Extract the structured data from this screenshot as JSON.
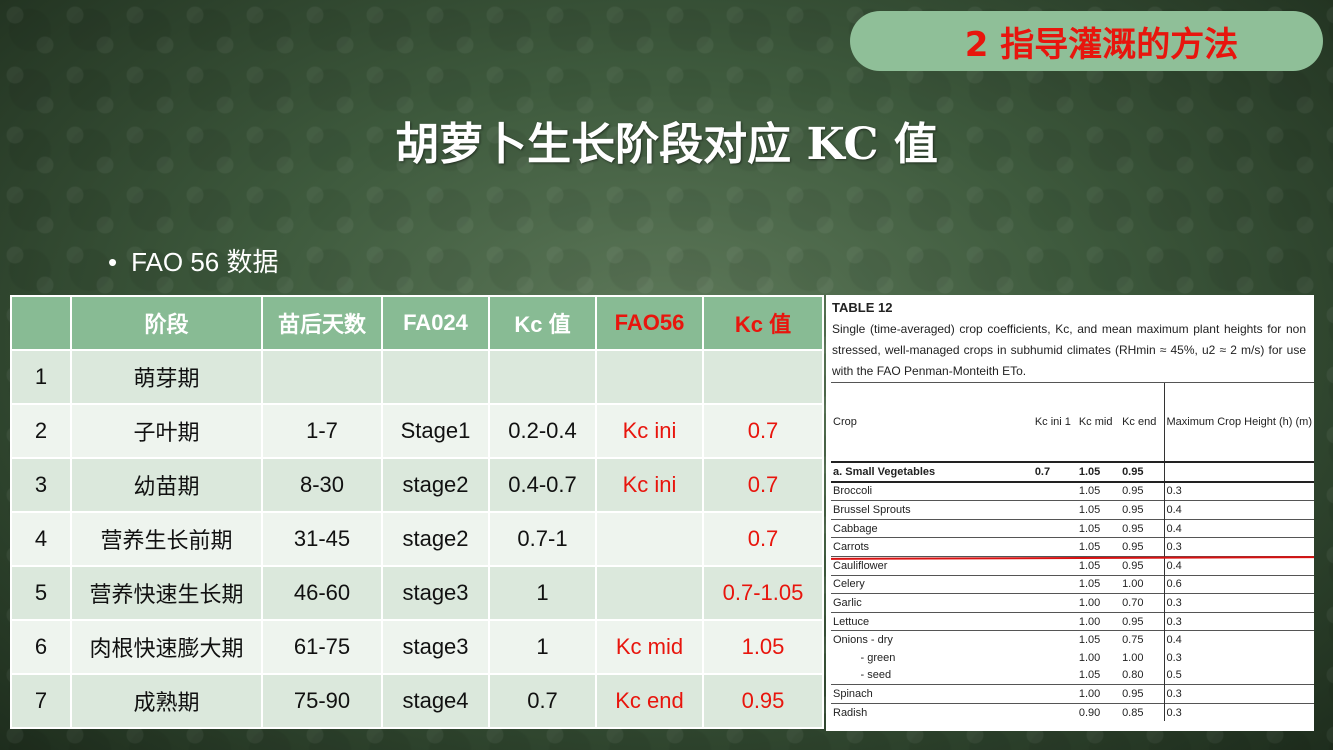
{
  "section_badge": "2 指导灌溉的方法",
  "title": "胡萝卜生长阶段对应 KC 值",
  "bullet": "FAO 56  数据",
  "table": {
    "headers": [
      "",
      "阶段",
      "苗后天数",
      "FA024",
      "Kc 值",
      "FAO56",
      "Kc 值"
    ],
    "rows": [
      [
        "1",
        "萌芽期",
        "",
        "",
        "",
        "",
        ""
      ],
      [
        "2",
        "子叶期",
        "1-7",
        "Stage1",
        "0.2-0.4",
        "Kc ini",
        "0.7"
      ],
      [
        "3",
        "幼苗期",
        "8-30",
        "stage2",
        "0.4-0.7",
        "Kc ini",
        "0.7"
      ],
      [
        "4",
        "营养生长前期",
        "31-45",
        "stage2",
        "0.7-1",
        "",
        "0.7"
      ],
      [
        "5",
        "营养快速生长期",
        "46-60",
        "stage3",
        "1",
        "",
        "0.7-1.05"
      ],
      [
        "6",
        "肉根快速膨大期",
        "61-75",
        "stage3",
        "1",
        "Kc mid",
        "1.05"
      ],
      [
        "7",
        "成熟期",
        "75-90",
        "stage4",
        "0.7",
        "Kc end",
        "0.95"
      ]
    ],
    "accent_color": "#e8150d",
    "header_bg": "#88bb94"
  },
  "fao_image": {
    "table_label": "TABLE 12",
    "caption": "Single (time-averaged) crop coefficients, Kc, and mean maximum plant heights for non stressed, well-managed crops in subhumid climates (RHmin ≈ 45%, u2 ≈ 2 m/s) for use with the FAO Penman-Monteith ETo.",
    "headers": [
      "Crop",
      "Kc ini 1",
      "Kc mid",
      "Kc end",
      "Maximum Crop Height (h) (m)"
    ],
    "section": [
      "a.  Small Vegetables",
      "0.7",
      "1.05",
      "0.95",
      ""
    ],
    "rows": [
      [
        "Broccoli",
        "",
        "1.05",
        "0.95",
        "0.3"
      ],
      [
        "Brussel Sprouts",
        "",
        "1.05",
        "0.95",
        "0.4"
      ],
      [
        "Cabbage",
        "",
        "1.05",
        "0.95",
        "0.4"
      ],
      [
        "Carrots",
        "",
        "1.05",
        "0.95",
        "0.3"
      ],
      [
        "Cauliflower",
        "",
        "1.05",
        "0.95",
        "0.4"
      ],
      [
        "Celery",
        "",
        "1.05",
        "1.00",
        "0.6"
      ],
      [
        "Garlic",
        "",
        "1.00",
        "0.70",
        "0.3"
      ],
      [
        "Lettuce",
        "",
        "1.00",
        "0.95",
        "0.3"
      ],
      [
        "Onions - dry",
        "",
        "1.05",
        "0.75",
        "0.4"
      ],
      [
        "         - green",
        "",
        "1.00",
        "1.00",
        "0.3"
      ],
      [
        "         - seed",
        "",
        "1.05",
        "0.80",
        "0.5"
      ],
      [
        "Spinach",
        "",
        "1.00",
        "0.95",
        "0.3"
      ],
      [
        "Radish",
        "",
        "0.90",
        "0.85",
        "0.3"
      ]
    ],
    "highlight_row": "Carrots",
    "highlight_color": "#d91111"
  }
}
